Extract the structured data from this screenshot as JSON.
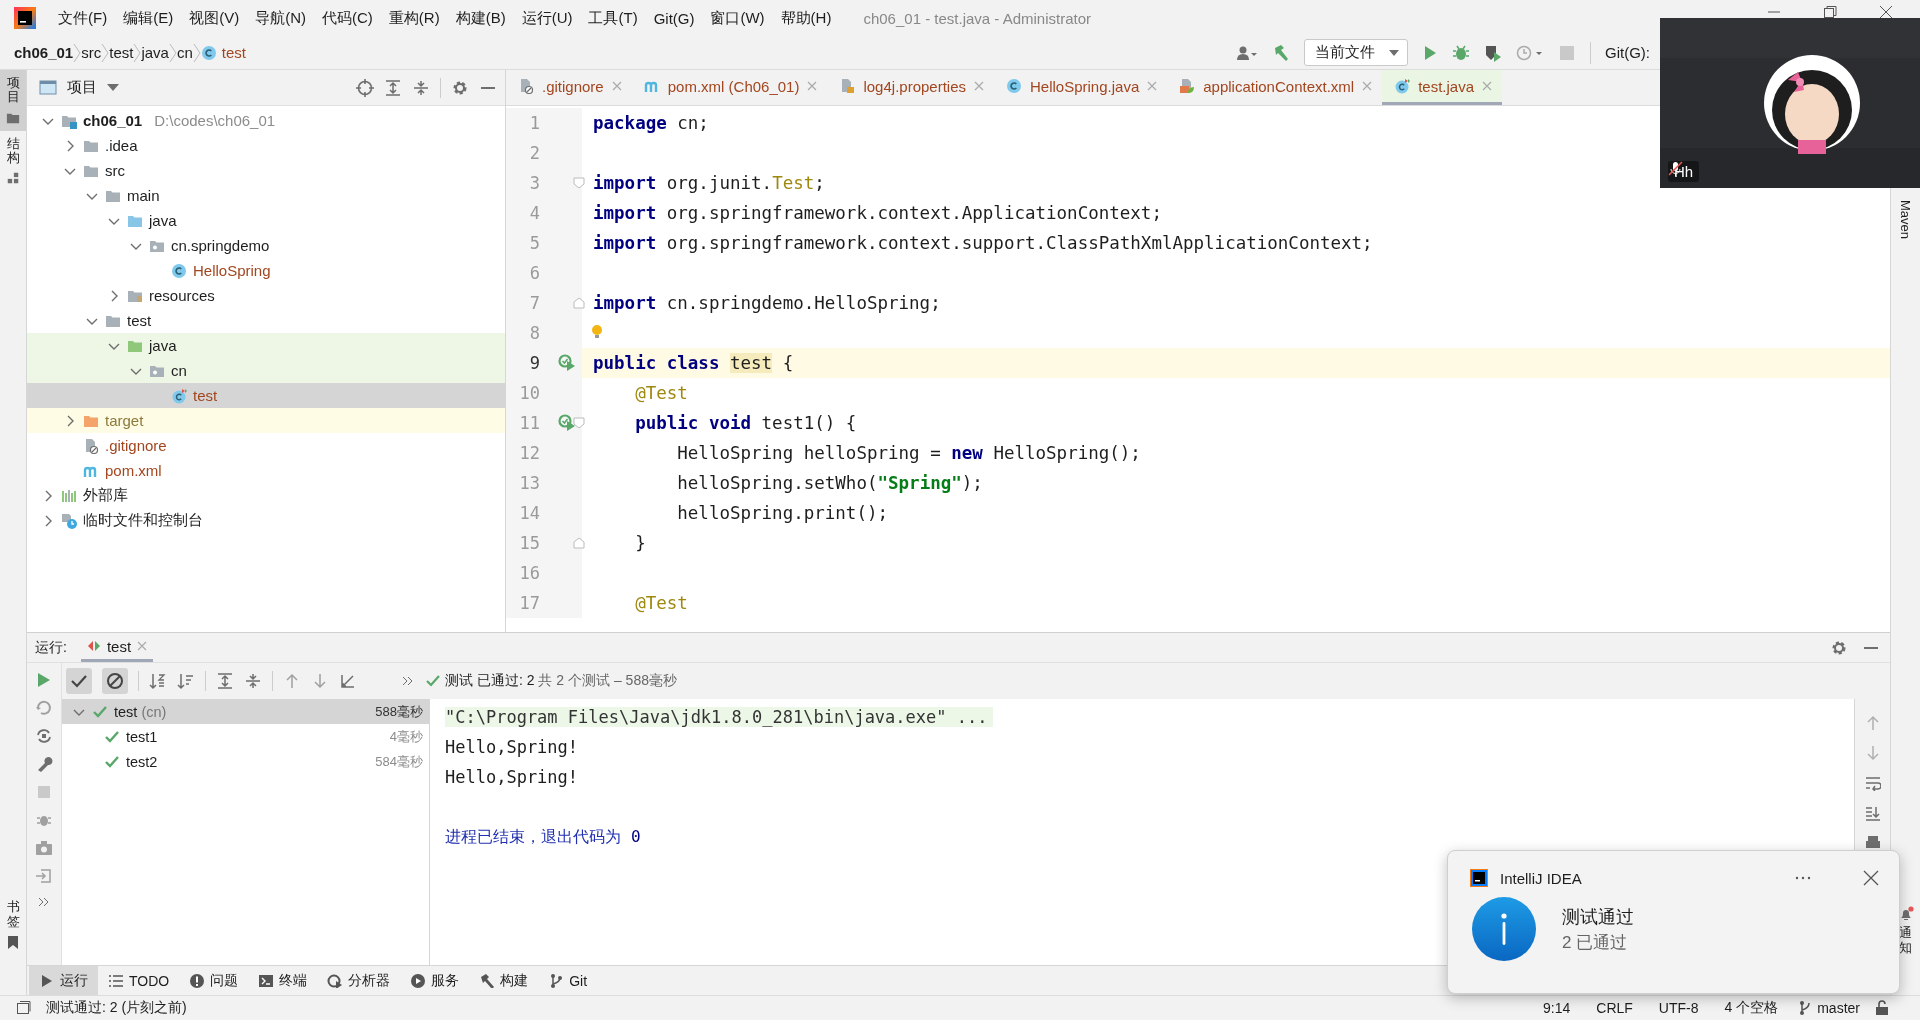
{
  "window": {
    "title": "ch06_01 - test.java - Administrator"
  },
  "menu": [
    "文件(F)",
    "编辑(E)",
    "视图(V)",
    "导航(N)",
    "代码(C)",
    "重构(R)",
    "构建(B)",
    "运行(U)",
    "工具(T)",
    "Git(G)",
    "窗口(W)",
    "帮助(H)"
  ],
  "breadcrumbs": [
    {
      "label": "ch06_01",
      "kind": "project"
    },
    {
      "label": "src",
      "kind": "dir"
    },
    {
      "label": "test",
      "kind": "dir"
    },
    {
      "label": "java",
      "kind": "dir"
    },
    {
      "label": "cn",
      "kind": "dir"
    },
    {
      "label": "test",
      "kind": "class"
    }
  ],
  "toolbar": {
    "run_config": "当前文件",
    "vcs_label": "Git(G):"
  },
  "left_strip": {
    "top": [
      {
        "label": "项目",
        "selected": true
      },
      {
        "label": "结构",
        "selected": false
      }
    ],
    "bottom": [
      {
        "label": "书签",
        "selected": false
      }
    ]
  },
  "right_strip": {
    "top": [
      {
        "label": "Maven"
      }
    ],
    "bottom": [
      {
        "label": "通知",
        "badge": true
      }
    ]
  },
  "project": {
    "title": "项目",
    "tree": [
      {
        "label": "ch06_01",
        "path": "D:\\codes\\ch06_01",
        "kind": "module",
        "expanded": true,
        "selected": false,
        "untracked": false,
        "test_root": false,
        "children": [
          {
            "label": ".idea",
            "kind": "folder",
            "expanded": false,
            "selected": false,
            "untracked": false,
            "test_root": false
          },
          {
            "label": "src",
            "kind": "folder",
            "expanded": true,
            "selected": false,
            "untracked": false,
            "test_root": false,
            "children": [
              {
                "label": "main",
                "kind": "folder",
                "expanded": true,
                "selected": false,
                "untracked": false,
                "test_root": false,
                "children": [
                  {
                    "label": "java",
                    "kind": "source",
                    "expanded": true,
                    "selected": false,
                    "untracked": false,
                    "test_root": false,
                    "children": [
                      {
                        "label": "cn.springdemo",
                        "kind": "package",
                        "expanded": true,
                        "selected": false,
                        "untracked": false,
                        "test_root": false,
                        "children": [
                          {
                            "label": "HelloSpring",
                            "kind": "class",
                            "selected": false,
                            "untracked": true,
                            "test_root": false
                          }
                        ]
                      }
                    ]
                  },
                  {
                    "label": "resources",
                    "kind": "resources",
                    "expanded": false,
                    "selected": false,
                    "untracked": false,
                    "test_root": false
                  }
                ]
              },
              {
                "label": "test",
                "kind": "folder",
                "expanded": true,
                "selected": false,
                "untracked": false,
                "test_root": false,
                "children": [
                  {
                    "label": "java",
                    "kind": "testsource",
                    "expanded": true,
                    "selected": false,
                    "untracked": false,
                    "test_root": true,
                    "children": [
                      {
                        "label": "cn",
                        "kind": "package",
                        "expanded": true,
                        "selected": false,
                        "untracked": false,
                        "test_root": true,
                        "children": [
                          {
                            "label": "test",
                            "kind": "testclass",
                            "selected": true,
                            "untracked": true
                          }
                        ]
                      }
                    ]
                  }
                ]
              }
            ]
          },
          {
            "label": "target",
            "kind": "excluded",
            "expanded": false,
            "selected": false,
            "untracked": false
          },
          {
            "label": ".gitignore",
            "kind": "gitignore",
            "selected": false,
            "untracked": true,
            "test_root": false
          },
          {
            "label": "pom.xml",
            "kind": "maven",
            "selected": false,
            "untracked": true,
            "test_root": false
          }
        ]
      },
      {
        "label": "外部库",
        "kind": "library",
        "expanded": false,
        "selected": false,
        "untracked": false,
        "test_root": false
      },
      {
        "label": "临时文件和控制台",
        "kind": "scratch",
        "expanded": false,
        "selected": false,
        "untracked": false,
        "test_root": false
      }
    ]
  },
  "editor": {
    "tabs": [
      {
        "label": ".gitignore",
        "kind": "gitignore",
        "untracked": true,
        "selected": false
      },
      {
        "label": "pom.xml (Ch06_01)",
        "kind": "maven",
        "untracked": true,
        "selected": false
      },
      {
        "label": "log4j.properties",
        "kind": "properties",
        "untracked": true,
        "selected": false
      },
      {
        "label": "HelloSpring.java",
        "kind": "class",
        "untracked": true,
        "selected": false
      },
      {
        "label": "applicationContext.xml",
        "kind": "xml",
        "untracked": true,
        "selected": false
      },
      {
        "label": "test.java",
        "kind": "testclass",
        "untracked": true,
        "selected": true
      }
    ],
    "lines": [
      {
        "number": "1",
        "current": false,
        "spans": [
          {
            "kind": "keyword",
            "text": "package"
          },
          {
            "kind": "plain",
            "text": " cn;"
          }
        ]
      },
      {
        "number": "2",
        "current": false
      },
      {
        "number": "3",
        "current": false,
        "fold_start": true,
        "spans": [
          {
            "kind": "keyword",
            "text": "import"
          },
          {
            "kind": "plain",
            "text": " org.junit."
          },
          {
            "kind": "type",
            "text": "Test"
          },
          {
            "kind": "plain",
            "text": ";"
          }
        ]
      },
      {
        "number": "4",
        "current": false,
        "spans": [
          {
            "kind": "keyword",
            "text": "import"
          },
          {
            "kind": "plain",
            "text": " org.springframework.context.ApplicationContext;"
          }
        ]
      },
      {
        "number": "5",
        "current": false,
        "spans": [
          {
            "kind": "keyword",
            "text": "import"
          },
          {
            "kind": "plain",
            "text": " org.springframework.context.support.ClassPathXmlApplicationContext;"
          }
        ]
      },
      {
        "number": "6",
        "current": false
      },
      {
        "number": "7",
        "current": false,
        "fold_end": true,
        "spans": [
          {
            "kind": "keyword",
            "text": "import"
          },
          {
            "kind": "plain",
            "text": " cn.springdemo.HelloSpring;"
          }
        ]
      },
      {
        "number": "8",
        "current": false,
        "bulb": true
      },
      {
        "number": "9",
        "current": true,
        "run_marker": true,
        "spans": [
          {
            "kind": "keyword",
            "text": "public class "
          },
          {
            "kind": "highlight",
            "text": "test"
          },
          {
            "kind": "plain",
            "text": " {"
          }
        ]
      },
      {
        "number": "10",
        "current": false,
        "spans": [
          {
            "kind": "annotation",
            "text": "    @Test"
          }
        ]
      },
      {
        "number": "11",
        "current": false,
        "run_marker": true,
        "fold_start": true,
        "spans": [
          {
            "kind": "keyword",
            "text": "    public void"
          },
          {
            "kind": "plain",
            "text": " test1() {"
          }
        ]
      },
      {
        "number": "12",
        "current": false,
        "spans": [
          {
            "kind": "plain",
            "text": "        HelloSpring helloSpring = "
          },
          {
            "kind": "keyword",
            "text": "new"
          },
          {
            "kind": "plain",
            "text": " HelloSpring();"
          }
        ]
      },
      {
        "number": "13",
        "current": false,
        "spans": [
          {
            "kind": "plain",
            "text": "        helloSpring.setWho("
          },
          {
            "kind": "string",
            "text": "\"Spring\""
          },
          {
            "kind": "plain",
            "text": ");"
          }
        ]
      },
      {
        "number": "14",
        "current": false,
        "spans": [
          {
            "kind": "plain",
            "text": "        helloSpring.print();"
          }
        ]
      },
      {
        "number": "15",
        "current": false,
        "fold_end": true,
        "spans": [
          {
            "kind": "plain",
            "text": "    }"
          }
        ]
      },
      {
        "number": "16",
        "current": false
      },
      {
        "number": "17",
        "current": false,
        "spans": [
          {
            "kind": "annotation",
            "text": "    @Test"
          }
        ]
      }
    ]
  },
  "run": {
    "label": "运行:",
    "tab": "test",
    "status": "测试 已通过: 2",
    "summary": "共 2 个测试 – 588毫秒",
    "tests": [
      {
        "name": "test",
        "suffix": "(cn)",
        "time": "588毫秒",
        "passed": true,
        "selected": true,
        "expanded": true,
        "children": [
          {
            "name": "test1",
            "time": "4毫秒",
            "passed": true,
            "selected": false
          },
          {
            "name": "test2",
            "time": "584毫秒",
            "passed": true,
            "selected": false
          }
        ]
      }
    ],
    "console": [
      {
        "kind": "command",
        "text": "\"C:\\Program Files\\Java\\jdk1.8.0_281\\bin\\java.exe\" ..."
      },
      {
        "kind": "output",
        "text": "Hello,Spring!"
      },
      {
        "kind": "output",
        "text": "Hello,Spring!"
      },
      {
        "kind": "blank"
      },
      {
        "kind": "exit",
        "text": "进程已结束，退出代码为",
        "code": "0"
      }
    ]
  },
  "tool_tabs": [
    {
      "label": "运行",
      "kind": "run",
      "selected": true
    },
    {
      "label": "TODO",
      "kind": "list",
      "selected": false
    },
    {
      "label": "问题",
      "kind": "problem",
      "selected": false
    },
    {
      "label": "终端",
      "kind": "terminal",
      "selected": false
    },
    {
      "label": "分析器",
      "kind": "profiler",
      "selected": false
    },
    {
      "label": "服务",
      "kind": "services",
      "selected": false
    },
    {
      "label": "构建",
      "kind": "hammer",
      "selected": false
    },
    {
      "label": "Git",
      "kind": "branch",
      "selected": false
    }
  ],
  "status_bar": {
    "message": "测试通过: 2 (片刻之前)",
    "items": [
      "9:14",
      "CRLF",
      "UTF-8",
      "4 个空格"
    ],
    "branch": "master"
  },
  "notification": {
    "app": "IntelliJ IDEA",
    "title": "测试通过",
    "body": "2 已通过"
  },
  "video": {
    "kind": "picture",
    "name": "Hh",
    "muted": true
  }
}
